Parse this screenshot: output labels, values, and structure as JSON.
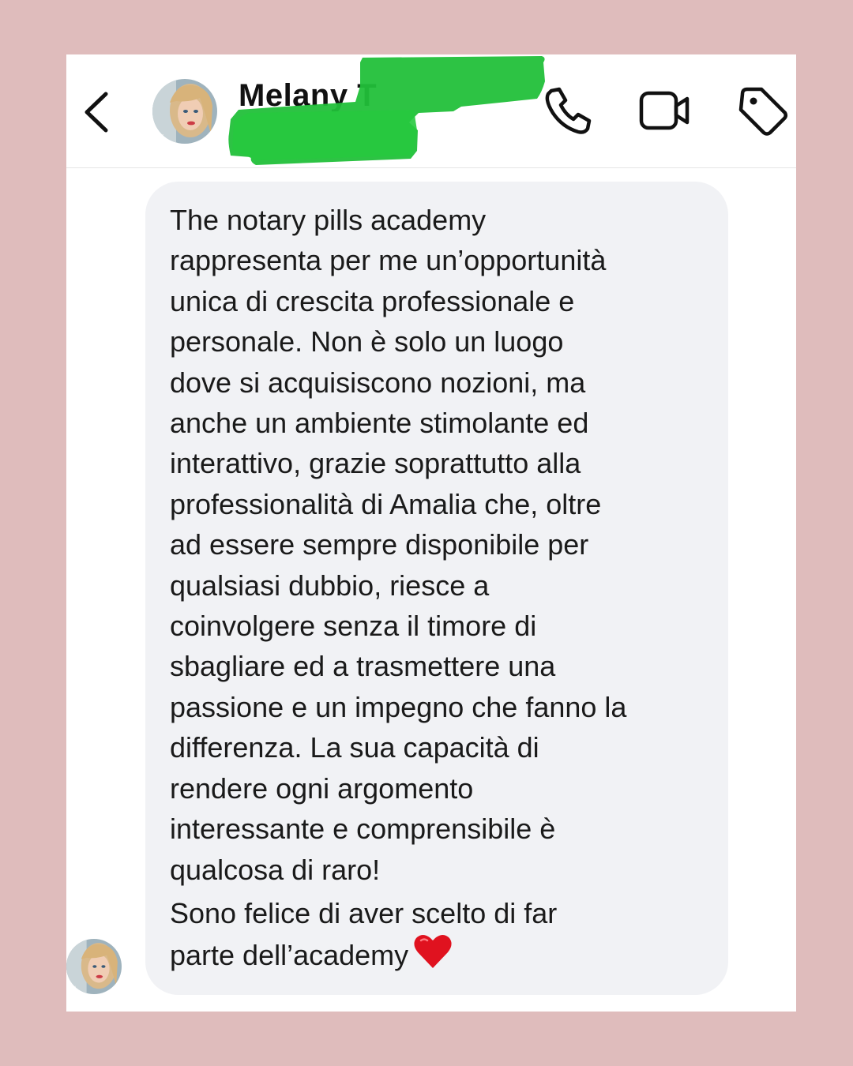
{
  "chat": {
    "contact_name": "Melany T",
    "back_icon": "chevron-left-icon",
    "avatar_icon": "contact-avatar",
    "actions": [
      {
        "name": "call",
        "icon": "phone-icon"
      },
      {
        "name": "video",
        "icon": "video-camera-icon"
      },
      {
        "name": "tag",
        "icon": "tag-icon"
      }
    ],
    "redaction_color": "#22c03a"
  },
  "message": {
    "lines": [
      "The notary pills academy",
      "rappresenta per me un’opportunità",
      "unica di crescita professionale e",
      "personale. Non è solo un luogo",
      "dove si acquisiscono nozioni, ma",
      "anche un ambiente stimolante ed",
      "interattivo, grazie soprattutto alla",
      "professionalità di Amalia che, oltre",
      "ad essere sempre disponibile per",
      "qualsiasi dubbio, riesce a",
      "coinvolgere senza il timore di",
      "sbagliare ed a trasmettere una",
      "passione e un impegno che fanno la",
      "differenza. La sua capacità di",
      "rendere ogni argomento",
      "interessante e comprensibile è",
      "qualcosa di raro!"
    ],
    "lines2": [
      "Sono felice di aver scelto di far",
      "parte dell’academy"
    ],
    "emoji": "heart-icon",
    "bubble_color": "#f1f2f5",
    "text_color": "#1a1a1a"
  },
  "page": {
    "background_color": "#dfbcbc",
    "frame_color": "#ffffff"
  }
}
